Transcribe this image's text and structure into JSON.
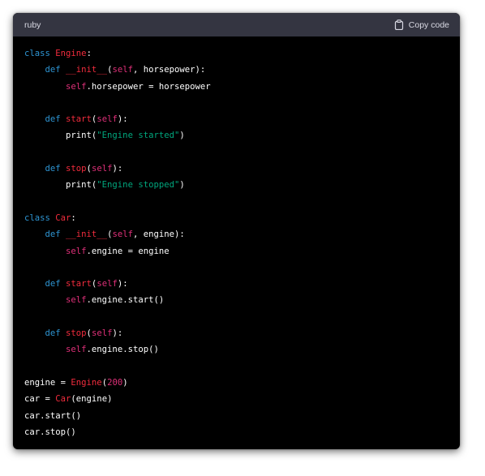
{
  "header": {
    "language": "ruby",
    "copy_label": "Copy code",
    "copy_icon": "clipboard-icon",
    "bg_color": "#343541"
  },
  "colors": {
    "keyword": "#2e95d3",
    "class_name": "#f22c3d",
    "self": "#df3079",
    "string": "#00a67d",
    "number": "#df3079",
    "plain": "#ffffff",
    "code_bg": "#000000"
  },
  "code_lines": [
    [
      {
        "t": "kw",
        "v": "class "
      },
      {
        "t": "cls",
        "v": "Engine"
      },
      {
        "t": "txt",
        "v": ":"
      }
    ],
    [
      {
        "t": "txt",
        "v": "    "
      },
      {
        "t": "kw",
        "v": "def "
      },
      {
        "t": "fn",
        "v": "__init__"
      },
      {
        "t": "txt",
        "v": "("
      },
      {
        "t": "self",
        "v": "self"
      },
      {
        "t": "txt",
        "v": ", horsepower):"
      }
    ],
    [
      {
        "t": "txt",
        "v": "        "
      },
      {
        "t": "self",
        "v": "self"
      },
      {
        "t": "txt",
        "v": ".horsepower = horsepower"
      }
    ],
    [],
    [
      {
        "t": "txt",
        "v": "    "
      },
      {
        "t": "kw",
        "v": "def "
      },
      {
        "t": "fn",
        "v": "start"
      },
      {
        "t": "txt",
        "v": "("
      },
      {
        "t": "self",
        "v": "self"
      },
      {
        "t": "txt",
        "v": "):"
      }
    ],
    [
      {
        "t": "txt",
        "v": "        print("
      },
      {
        "t": "str",
        "v": "\"Engine started\""
      },
      {
        "t": "txt",
        "v": ")"
      }
    ],
    [],
    [
      {
        "t": "txt",
        "v": "    "
      },
      {
        "t": "kw",
        "v": "def "
      },
      {
        "t": "fn",
        "v": "stop"
      },
      {
        "t": "txt",
        "v": "("
      },
      {
        "t": "self",
        "v": "self"
      },
      {
        "t": "txt",
        "v": "):"
      }
    ],
    [
      {
        "t": "txt",
        "v": "        print("
      },
      {
        "t": "str",
        "v": "\"Engine stopped\""
      },
      {
        "t": "txt",
        "v": ")"
      }
    ],
    [],
    [
      {
        "t": "kw",
        "v": "class "
      },
      {
        "t": "cls",
        "v": "Car"
      },
      {
        "t": "txt",
        "v": ":"
      }
    ],
    [
      {
        "t": "txt",
        "v": "    "
      },
      {
        "t": "kw",
        "v": "def "
      },
      {
        "t": "fn",
        "v": "__init__"
      },
      {
        "t": "txt",
        "v": "("
      },
      {
        "t": "self",
        "v": "self"
      },
      {
        "t": "txt",
        "v": ", engine):"
      }
    ],
    [
      {
        "t": "txt",
        "v": "        "
      },
      {
        "t": "self",
        "v": "self"
      },
      {
        "t": "txt",
        "v": ".engine = engine"
      }
    ],
    [],
    [
      {
        "t": "txt",
        "v": "    "
      },
      {
        "t": "kw",
        "v": "def "
      },
      {
        "t": "fn",
        "v": "start"
      },
      {
        "t": "txt",
        "v": "("
      },
      {
        "t": "self",
        "v": "self"
      },
      {
        "t": "txt",
        "v": "):"
      }
    ],
    [
      {
        "t": "txt",
        "v": "        "
      },
      {
        "t": "self",
        "v": "self"
      },
      {
        "t": "txt",
        "v": ".engine.start()"
      }
    ],
    [],
    [
      {
        "t": "txt",
        "v": "    "
      },
      {
        "t": "kw",
        "v": "def "
      },
      {
        "t": "fn",
        "v": "stop"
      },
      {
        "t": "txt",
        "v": "("
      },
      {
        "t": "self",
        "v": "self"
      },
      {
        "t": "txt",
        "v": "):"
      }
    ],
    [
      {
        "t": "txt",
        "v": "        "
      },
      {
        "t": "self",
        "v": "self"
      },
      {
        "t": "txt",
        "v": ".engine.stop()"
      }
    ],
    [],
    [
      {
        "t": "txt",
        "v": "engine = "
      },
      {
        "t": "cls",
        "v": "Engine"
      },
      {
        "t": "txt",
        "v": "("
      },
      {
        "t": "num",
        "v": "200"
      },
      {
        "t": "txt",
        "v": ")"
      }
    ],
    [
      {
        "t": "txt",
        "v": "car = "
      },
      {
        "t": "cls",
        "v": "Car"
      },
      {
        "t": "txt",
        "v": "(engine)"
      }
    ],
    [
      {
        "t": "txt",
        "v": "car.start()"
      }
    ],
    [
      {
        "t": "txt",
        "v": "car.stop()"
      }
    ]
  ]
}
